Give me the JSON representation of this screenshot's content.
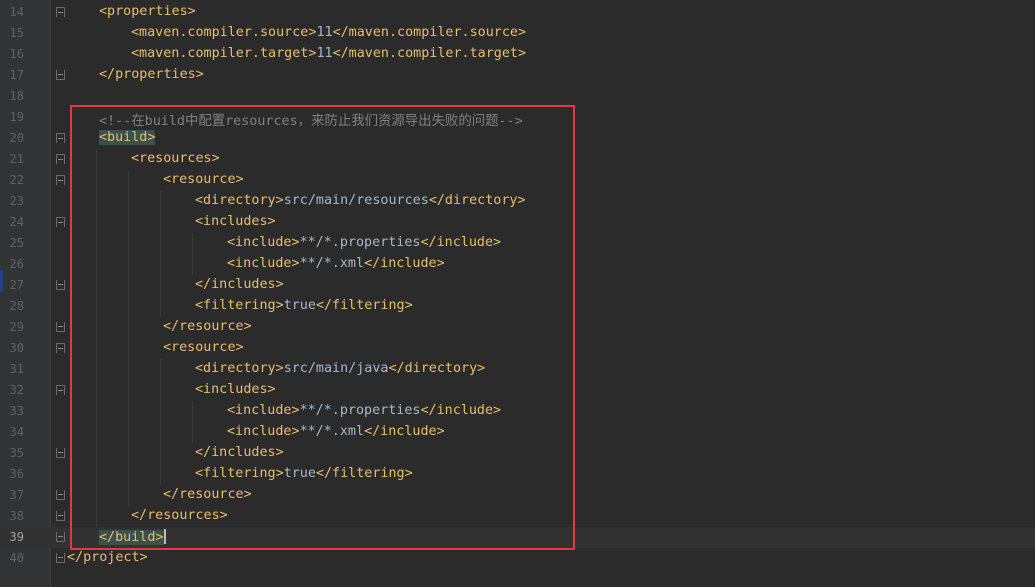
{
  "editor": {
    "language": "xml",
    "current_line": "39",
    "annotation_color": "#e43a3d",
    "lines": [
      {
        "num": "14",
        "fold": "open",
        "indent": 1,
        "parts": [
          {
            "c": "tag",
            "t": "<properties>"
          }
        ]
      },
      {
        "num": "15",
        "fold": "",
        "indent": 2,
        "parts": [
          {
            "c": "tag",
            "t": "<maven.compiler.source>"
          },
          {
            "c": "val",
            "t": "11"
          },
          {
            "c": "tag",
            "t": "</maven.compiler.source>"
          }
        ]
      },
      {
        "num": "16",
        "fold": "",
        "indent": 2,
        "parts": [
          {
            "c": "tag",
            "t": "<maven.compiler.target>"
          },
          {
            "c": "val",
            "t": "11"
          },
          {
            "c": "tag",
            "t": "</maven.compiler.target>"
          }
        ]
      },
      {
        "num": "17",
        "fold": "close",
        "indent": 1,
        "parts": [
          {
            "c": "tag",
            "t": "</properties>"
          }
        ]
      },
      {
        "num": "18",
        "fold": "",
        "indent": 0,
        "parts": []
      },
      {
        "num": "19",
        "fold": "",
        "indent": 1,
        "parts": [
          {
            "c": "cmt",
            "t": "<!--在build中配置resources，来防止我们资源导出失败的问题-->"
          }
        ]
      },
      {
        "num": "20",
        "fold": "open",
        "indent": 1,
        "parts": [
          {
            "c": "tag hl",
            "t": "<build>"
          }
        ]
      },
      {
        "num": "21",
        "fold": "open",
        "indent": 2,
        "parts": [
          {
            "c": "tag",
            "t": "<resources>"
          }
        ]
      },
      {
        "num": "22",
        "fold": "open",
        "indent": 3,
        "parts": [
          {
            "c": "tag",
            "t": "<resource>"
          }
        ]
      },
      {
        "num": "23",
        "fold": "",
        "indent": 4,
        "parts": [
          {
            "c": "tag",
            "t": "<directory>"
          },
          {
            "c": "val",
            "t": "src/main/resources"
          },
          {
            "c": "tag",
            "t": "</directory>"
          }
        ]
      },
      {
        "num": "24",
        "fold": "open",
        "indent": 4,
        "parts": [
          {
            "c": "tag",
            "t": "<includes>"
          }
        ]
      },
      {
        "num": "25",
        "fold": "",
        "indent": 5,
        "parts": [
          {
            "c": "tag",
            "t": "<include>"
          },
          {
            "c": "val",
            "t": "**/*.properties"
          },
          {
            "c": "tag",
            "t": "</include>"
          }
        ]
      },
      {
        "num": "26",
        "fold": "",
        "indent": 5,
        "parts": [
          {
            "c": "tag",
            "t": "<include>"
          },
          {
            "c": "val",
            "t": "**/*.xml"
          },
          {
            "c": "tag",
            "t": "</include>"
          }
        ]
      },
      {
        "num": "27",
        "fold": "close",
        "indent": 4,
        "parts": [
          {
            "c": "tag",
            "t": "</includes>"
          }
        ]
      },
      {
        "num": "28",
        "fold": "",
        "indent": 4,
        "parts": [
          {
            "c": "tag",
            "t": "<filtering>"
          },
          {
            "c": "val",
            "t": "true"
          },
          {
            "c": "tag",
            "t": "</filtering>"
          }
        ]
      },
      {
        "num": "29",
        "fold": "close",
        "indent": 3,
        "parts": [
          {
            "c": "tag",
            "t": "</resource>"
          }
        ]
      },
      {
        "num": "30",
        "fold": "open",
        "indent": 3,
        "parts": [
          {
            "c": "tag",
            "t": "<resource>"
          }
        ]
      },
      {
        "num": "31",
        "fold": "",
        "indent": 4,
        "parts": [
          {
            "c": "tag",
            "t": "<directory>"
          },
          {
            "c": "val",
            "t": "src/main/java"
          },
          {
            "c": "tag",
            "t": "</directory>"
          }
        ]
      },
      {
        "num": "32",
        "fold": "open",
        "indent": 4,
        "parts": [
          {
            "c": "tag",
            "t": "<includes>"
          }
        ]
      },
      {
        "num": "33",
        "fold": "",
        "indent": 5,
        "parts": [
          {
            "c": "tag",
            "t": "<include>"
          },
          {
            "c": "val",
            "t": "**/*.properties"
          },
          {
            "c": "tag",
            "t": "</include>"
          }
        ]
      },
      {
        "num": "34",
        "fold": "",
        "indent": 5,
        "parts": [
          {
            "c": "tag",
            "t": "<include>"
          },
          {
            "c": "val",
            "t": "**/*.xml"
          },
          {
            "c": "tag",
            "t": "</include>"
          }
        ]
      },
      {
        "num": "35",
        "fold": "close",
        "indent": 4,
        "parts": [
          {
            "c": "tag",
            "t": "</includes>"
          }
        ]
      },
      {
        "num": "36",
        "fold": "",
        "indent": 4,
        "parts": [
          {
            "c": "tag",
            "t": "<filtering>"
          },
          {
            "c": "val",
            "t": "true"
          },
          {
            "c": "tag",
            "t": "</filtering>"
          }
        ]
      },
      {
        "num": "37",
        "fold": "close",
        "indent": 3,
        "parts": [
          {
            "c": "tag",
            "t": "</resource>"
          }
        ]
      },
      {
        "num": "38",
        "fold": "close",
        "indent": 2,
        "parts": [
          {
            "c": "tag",
            "t": "</resources>"
          }
        ]
      },
      {
        "num": "39",
        "fold": "close",
        "indent": 1,
        "parts": [
          {
            "c": "tag hl",
            "t": "</build>"
          }
        ]
      },
      {
        "num": "40",
        "fold": "close",
        "indent": 0,
        "parts": [
          {
            "c": "tag",
            "t": "</project>"
          }
        ]
      }
    ]
  }
}
